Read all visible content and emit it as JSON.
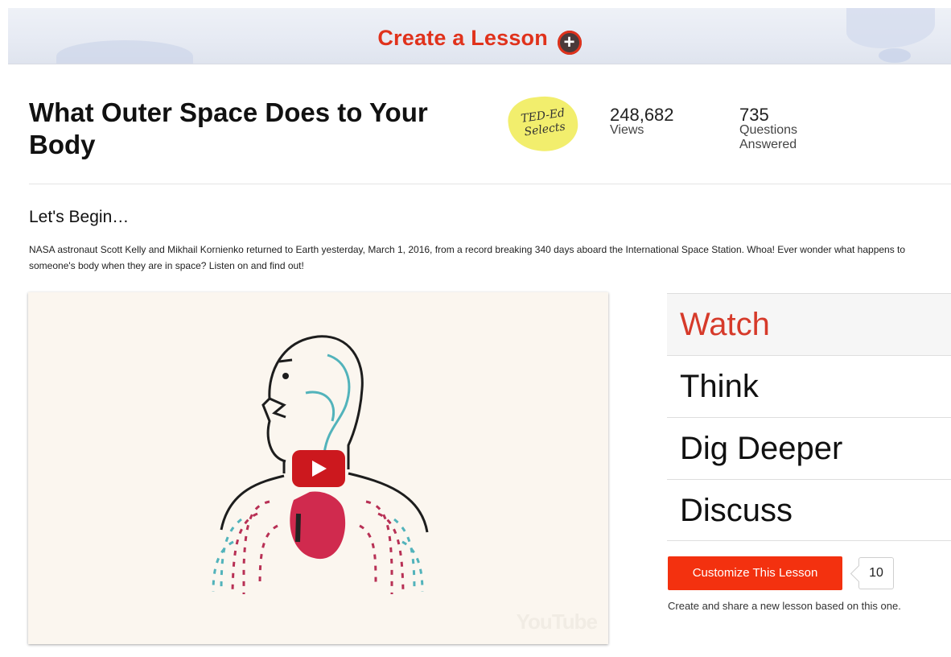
{
  "banner": {
    "create_label": "Create a Lesson",
    "plus_icon": "plus-circle-icon"
  },
  "lesson": {
    "title": "What Outer Space Does to Your Body",
    "badge_text": "TED-Ed Selects",
    "views_count": "248,682",
    "views_label": "Views",
    "questions_count": "735",
    "questions_label_line1": "Questions",
    "questions_label_line2": "Answered"
  },
  "intro": {
    "heading": "Let's Begin…",
    "description": "NASA astronaut Scott Kelly and Mikhail Kornienko returned to Earth yesterday, March 1, 2016, from a record breaking 340 days aboard the International Space Station. Whoa! Ever wonder what happens to someone's body when they are in space? Listen on and find out!"
  },
  "video": {
    "play_icon": "youtube-play-icon",
    "watermark": "YouTube"
  },
  "tabs": [
    {
      "label": "Watch",
      "active": true
    },
    {
      "label": "Think",
      "active": false
    },
    {
      "label": "Dig Deeper",
      "active": false
    },
    {
      "label": "Discuss",
      "active": false
    }
  ],
  "customize": {
    "button_label": "Customize This Lesson",
    "count": "10",
    "note": "Create and share a new lesson based on this one."
  },
  "colors": {
    "accent": "#e0321c",
    "button": "#f3310f",
    "badge": "#f2ee6d"
  }
}
